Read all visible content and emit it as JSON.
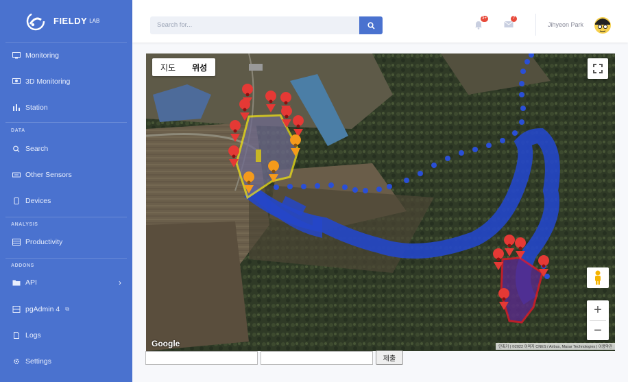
{
  "brand": {
    "name": "FIELDY",
    "sup": "LAB"
  },
  "nav": {
    "monitoring": "Monitoring",
    "monitoring_3d": "3D Monitoring",
    "station": "Station",
    "section_data": "DATA",
    "search": "Search",
    "other_sensors": "Other Sensors",
    "devices": "Devices",
    "section_analysis": "ANALYSIS",
    "productivity": "Productivity",
    "section_addons": "ADDONS",
    "api": "API",
    "pgadmin": "pgAdmin 4",
    "logs": "Logs",
    "settings": "Settings"
  },
  "topbar": {
    "search_placeholder": "Search for...",
    "alerts_count": "3+",
    "messages_count": "7",
    "user_name": "Jihyeon Park"
  },
  "map": {
    "type_map": "지도",
    "type_satellite": "위성",
    "selected_type": "위성",
    "logo": "Google",
    "attribution": "단축키 | ©2022 이미지 CNES / Airbus, Maxar Technologies | 이용약관",
    "zoom_in": "+",
    "zoom_out": "−"
  },
  "form": {
    "submit_label": "제출"
  },
  "colors": {
    "sidebar": "#4a72cf",
    "accent": "#4a72cf",
    "track": "#2447c9",
    "polygon_yellow": "#f0e21a",
    "polygon_red": "#e0192b",
    "marker_red": "#e53935",
    "marker_orange": "#f59a1b"
  }
}
